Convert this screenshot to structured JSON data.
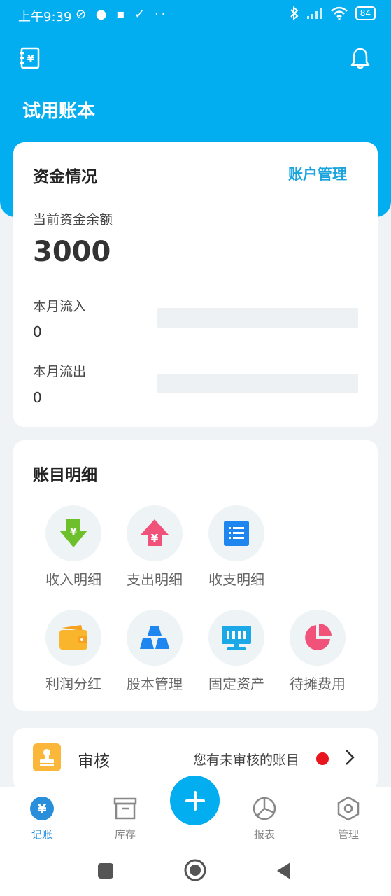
{
  "status_bar": {
    "time": "上午9:39",
    "left_icons": "⊘ ● ▪ ✓ ··",
    "battery": "84"
  },
  "header": {
    "book_title": "试用账本",
    "left_icon": "ledger-icon",
    "right_icon": "bell-icon"
  },
  "fund_card": {
    "title": "资金情况",
    "manage_link": "账户管理",
    "balance_label": "当前资金余额",
    "balance": "3000",
    "inflow_label": "本月流入",
    "inflow_value": "0",
    "inflow_fraction": 0,
    "outflow_label": "本月流出",
    "outflow_value": "0",
    "outflow_fraction": 0
  },
  "detail_card": {
    "title": "账目明细",
    "items": [
      {
        "label": "收入明细",
        "icon": "income-arrow-down-icon",
        "color": "#6dbf2c"
      },
      {
        "label": "支出明细",
        "icon": "expense-arrow-up-icon",
        "color": "#f0527a"
      },
      {
        "label": "收支明细",
        "icon": "list-icon",
        "color": "#1f86f0"
      },
      {
        "label": "利润分红",
        "icon": "wallet-icon",
        "color": "#f9b62c"
      },
      {
        "label": "股本管理",
        "icon": "stack-icon",
        "color": "#1f86f0"
      },
      {
        "label": "固定资产",
        "icon": "monitor-icon",
        "color": "#1aa8e6"
      },
      {
        "label": "待摊费用",
        "icon": "pie-icon",
        "color": "#f0527a"
      }
    ]
  },
  "audit_card": {
    "title": "审核",
    "message": "您有未审核的账目"
  },
  "bottom_nav": {
    "items": [
      {
        "label": "记账",
        "icon": "yen-circle-icon"
      },
      {
        "label": "库存",
        "icon": "archive-box-icon"
      },
      {
        "label": "报表",
        "icon": "pie-chart-icon"
      },
      {
        "label": "管理",
        "icon": "hexagon-settings-icon"
      }
    ],
    "fab_icon": "plus-icon"
  },
  "colors": {
    "primary": "#03aef0",
    "link": "#1aa4df",
    "alert_dot": "#e8141e"
  }
}
